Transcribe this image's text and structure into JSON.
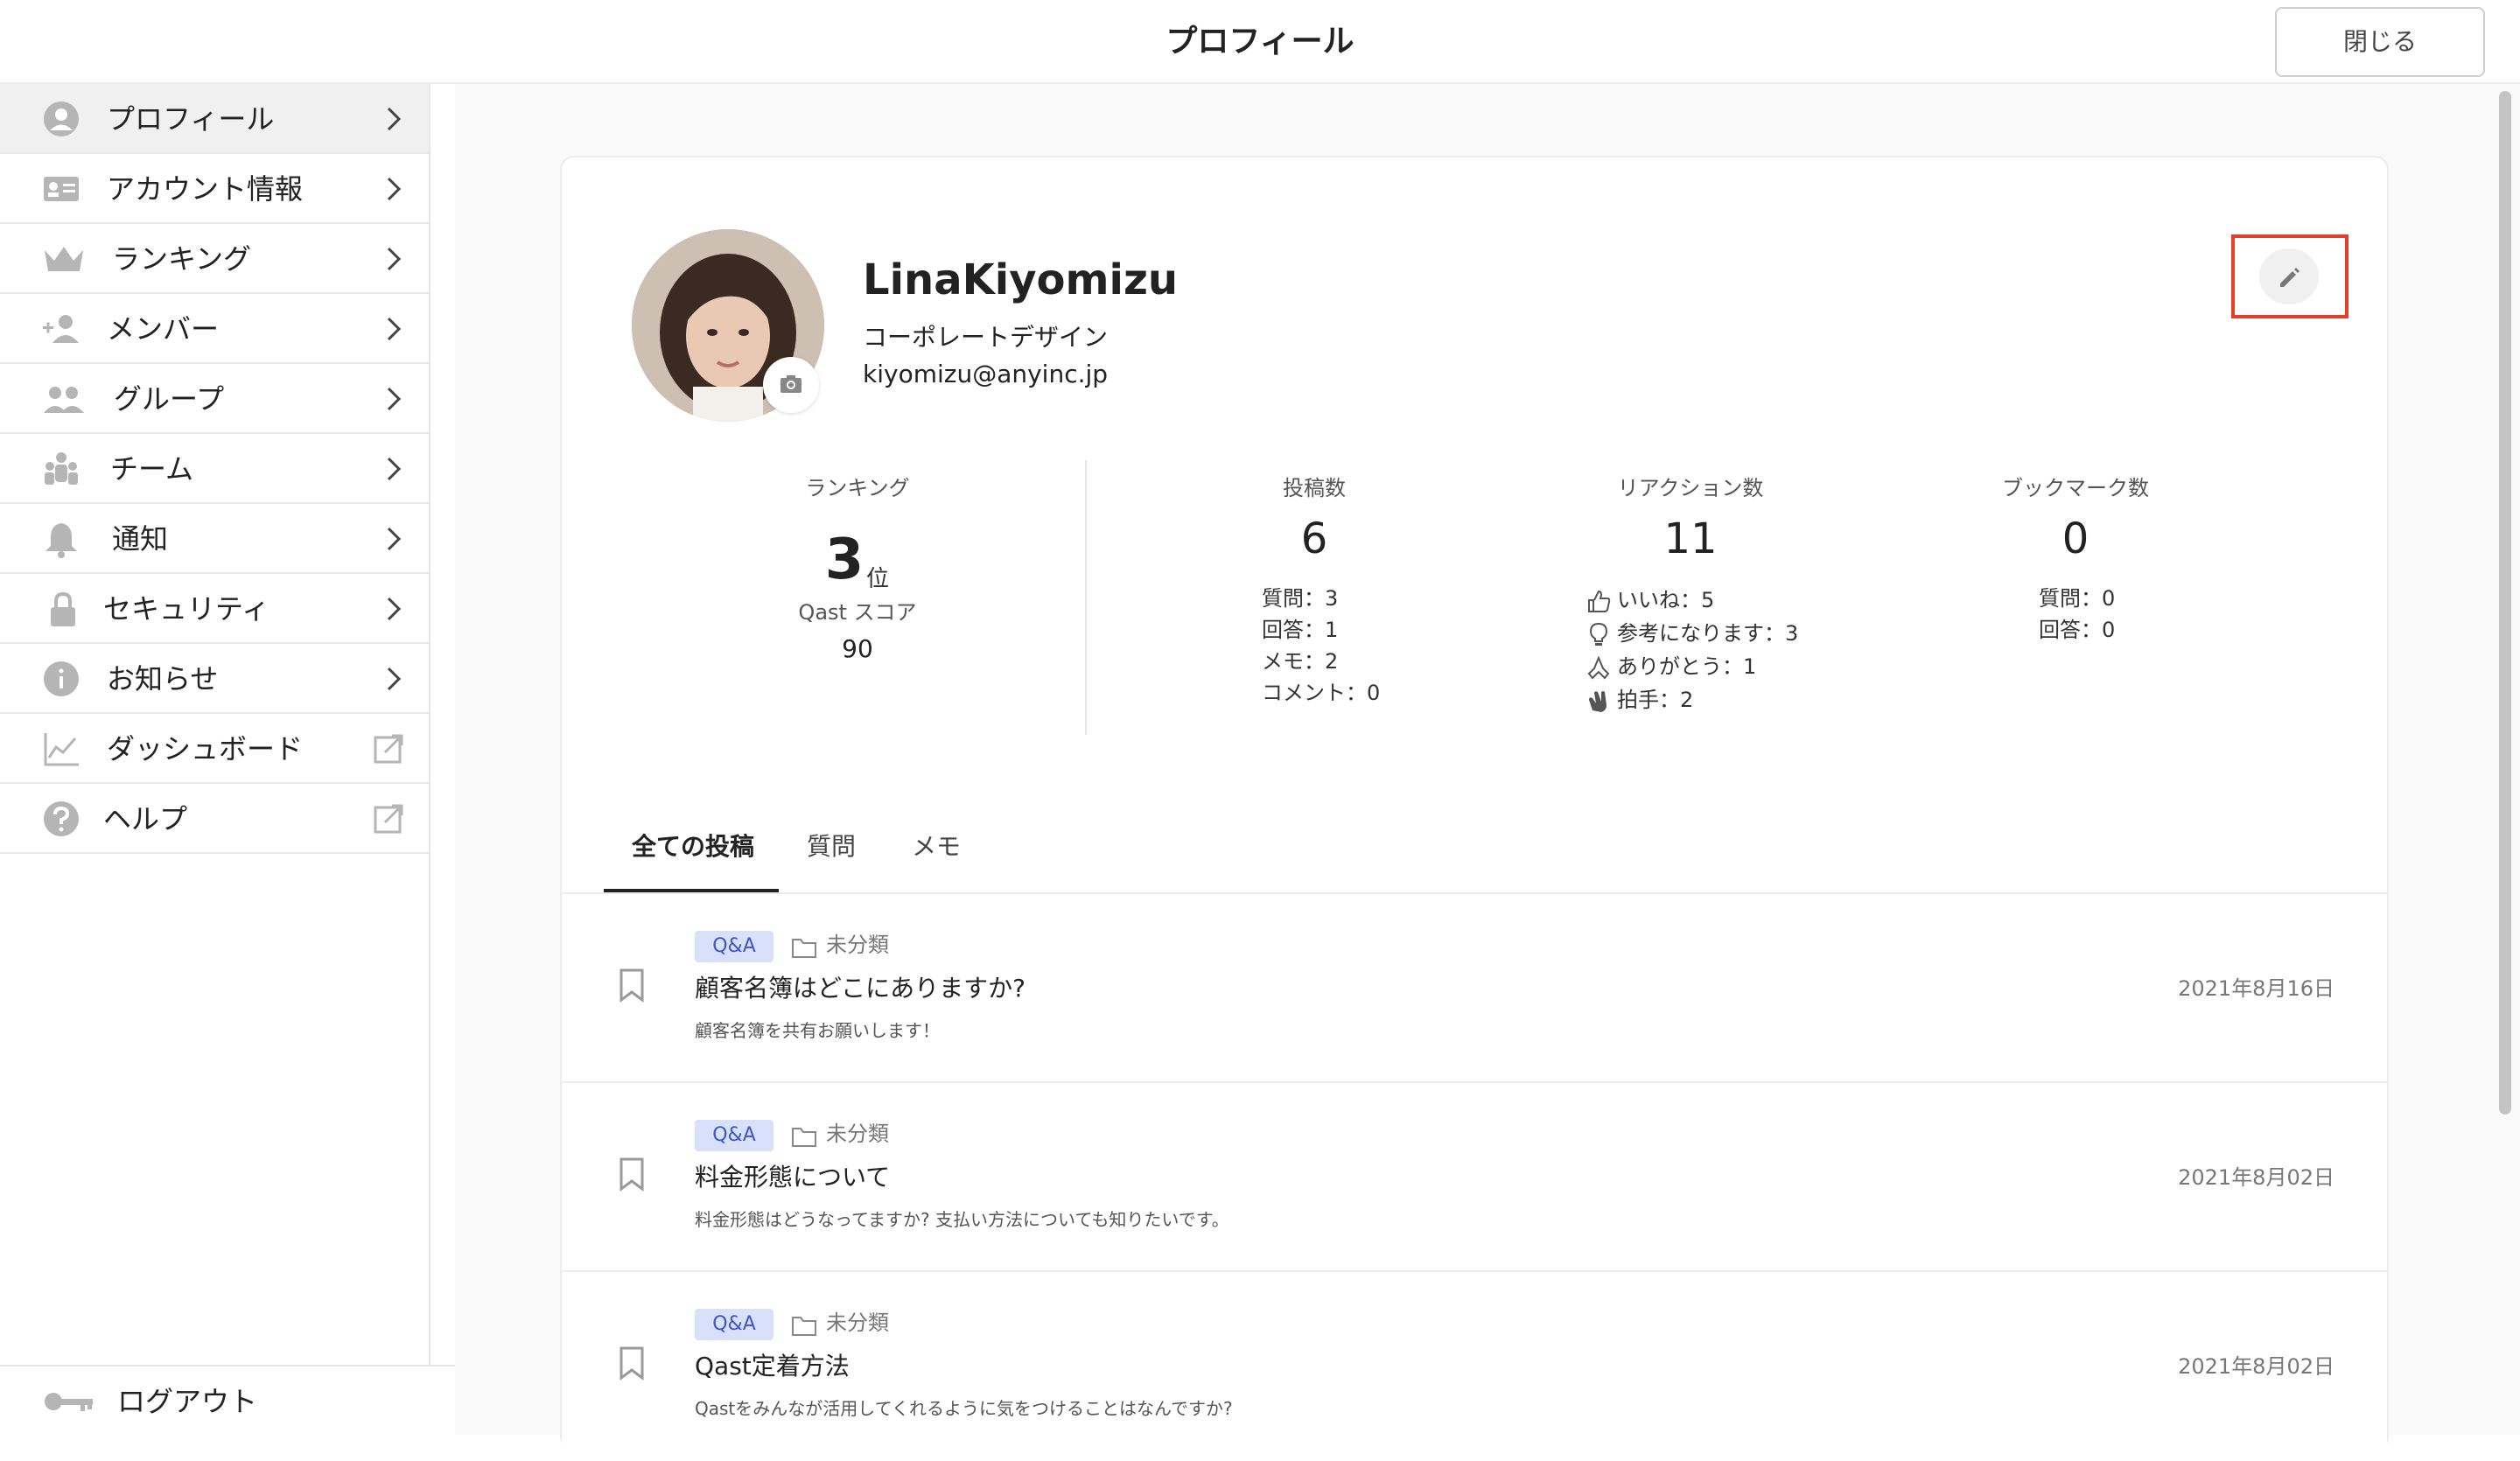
{
  "header": {
    "title": "プロフィール",
    "close_label": "閉じる"
  },
  "sidebar": {
    "items": [
      {
        "label": "プロフィール"
      },
      {
        "label": "アカウント情報"
      },
      {
        "label": "ランキング"
      },
      {
        "label": "メンバー"
      },
      {
        "label": "グループ"
      },
      {
        "label": "チーム"
      },
      {
        "label": "通知"
      },
      {
        "label": "セキュリティ"
      },
      {
        "label": "お知らせ"
      },
      {
        "label": "ダッシュボード"
      },
      {
        "label": "ヘルプ"
      }
    ],
    "logout_label": "ログアウト"
  },
  "profile": {
    "name": "LinaKiyomizu",
    "department": "コーポレートデザイン",
    "email": "kiyomizu@anyinc.jp"
  },
  "stats": {
    "ranking": {
      "label": "ランキング",
      "rank": "3",
      "rank_suffix": "位",
      "score_label": "Qast スコア",
      "score": "90"
    },
    "posts": {
      "label": "投稿数",
      "value": "6",
      "lines": [
        "質問：3",
        "回答：1",
        "メモ：2",
        "コメント：0"
      ]
    },
    "reactions": {
      "label": "リアクション数",
      "value": "11",
      "lines": [
        "いいね：5",
        "参考になります：3",
        "ありがとう：1",
        "拍手：2"
      ]
    },
    "bookmarks": {
      "label": "ブックマーク数",
      "value": "0",
      "lines": [
        "質問：0",
        "回答：0"
      ]
    }
  },
  "tabs": [
    {
      "label": "全ての投稿"
    },
    {
      "label": "質問"
    },
    {
      "label": "メモ"
    }
  ],
  "posts": [
    {
      "badge": "Q&A",
      "category": "未分類",
      "title": "顧客名簿はどこにありますか?",
      "excerpt": "顧客名簿を共有お願いします！",
      "date": "2021年8月16日"
    },
    {
      "badge": "Q&A",
      "category": "未分類",
      "title": "料金形態について",
      "excerpt": "料金形態はどうなってますか? 支払い方法についても知りたいです。",
      "date": "2021年8月02日"
    },
    {
      "badge": "Q&A",
      "category": "未分類",
      "title": "Qast定着方法",
      "excerpt": "Qastをみんなが活用してくれるように気をつけることはなんですか?",
      "date": "2021年8月02日"
    }
  ]
}
